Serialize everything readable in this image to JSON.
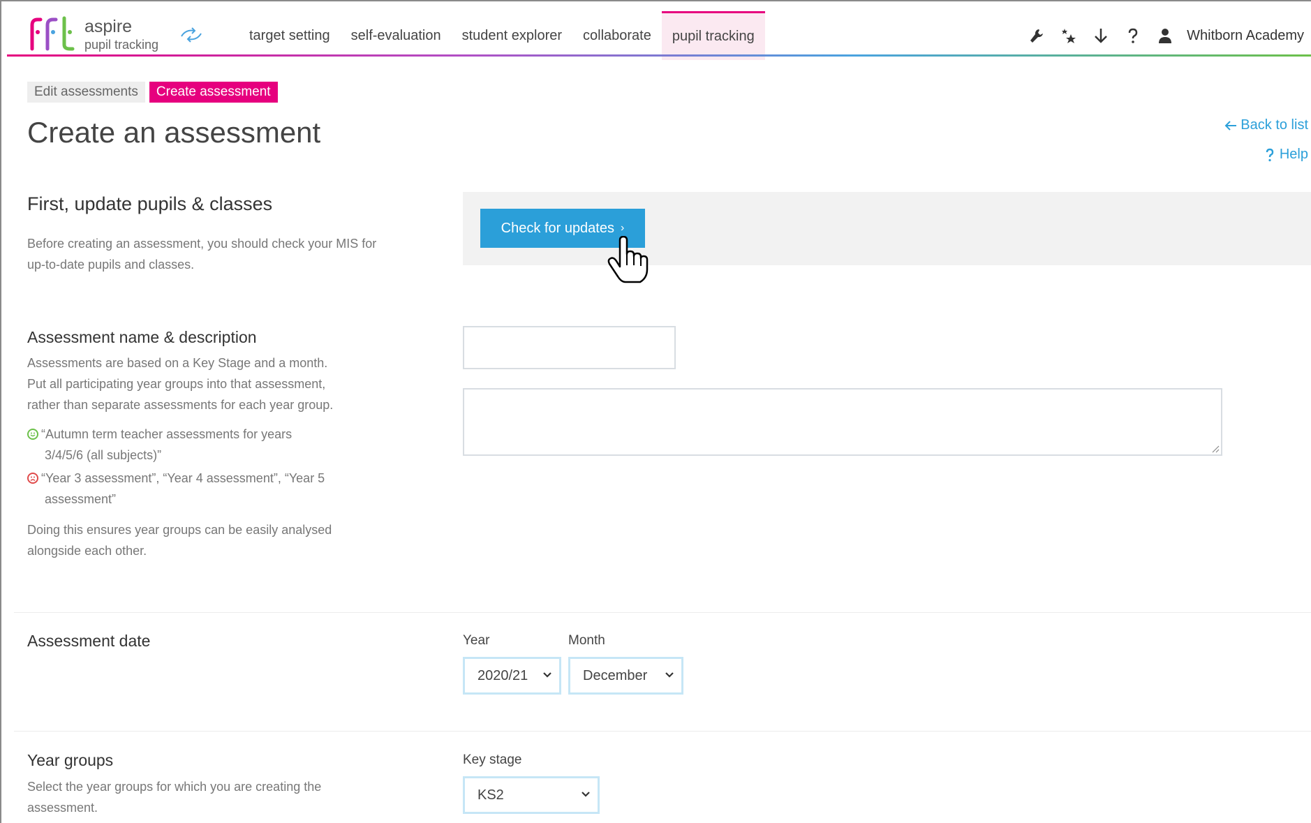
{
  "header": {
    "brand_title": "aspire",
    "brand_subtitle": "pupil tracking",
    "nav": [
      {
        "label": "target setting"
      },
      {
        "label": "self-evaluation"
      },
      {
        "label": "student explorer"
      },
      {
        "label": "collaborate"
      },
      {
        "label": "pupil tracking",
        "active": true
      }
    ],
    "school_name": "Whitborn Academy",
    "tool_icons": [
      "wrench-icon",
      "stars-icon",
      "download-arrow-icon",
      "help-question-icon",
      "user-icon"
    ]
  },
  "breadcrumb": {
    "edit_label": "Edit assessments",
    "create_label": "Create assessment"
  },
  "page": {
    "title": "Create an assessment",
    "back_link": "Back to list",
    "help_link": "Help"
  },
  "update_section": {
    "title": "First, update pupils & classes",
    "desc_line1": "Before creating an assessment, you should check your MIS for",
    "desc_line2": "up-to-date pupils and classes.",
    "button_label": "Check for updates"
  },
  "name_section": {
    "title": "Assessment name & description",
    "desc_line1": "Assessments are based on a Key Stage and a month.",
    "desc_line2": "Put all participating year groups into that assessment,",
    "desc_line3": "rather than separate assessments for each year group.",
    "good_line1": "“Autumn term teacher assessments for years",
    "good_line2": "3/4/5/6 (all subjects)”",
    "bad_line1": "“Year 3 assessment”, “Year 4 assessment”, “Year 5",
    "bad_line2": "assessment”",
    "footer_line1": "Doing this ensures year groups can be easily analysed",
    "footer_line2": "alongside each other.",
    "name_value": "",
    "description_value": ""
  },
  "date_section": {
    "title": "Assessment date",
    "year_label": "Year",
    "year_value": "2020/21",
    "month_label": "Month",
    "month_value": "December"
  },
  "year_groups_section": {
    "title": "Year groups",
    "desc_line1": "Select the year groups for which you are creating the",
    "desc_line2": "assessment.",
    "key_stage_label": "Key stage",
    "key_stage_value": "KS2"
  },
  "colors": {
    "accent_pink": "#e6007e",
    "accent_blue": "#2b9fd9",
    "good_green": "#6cc04a",
    "bad_red": "#e04a4a"
  }
}
